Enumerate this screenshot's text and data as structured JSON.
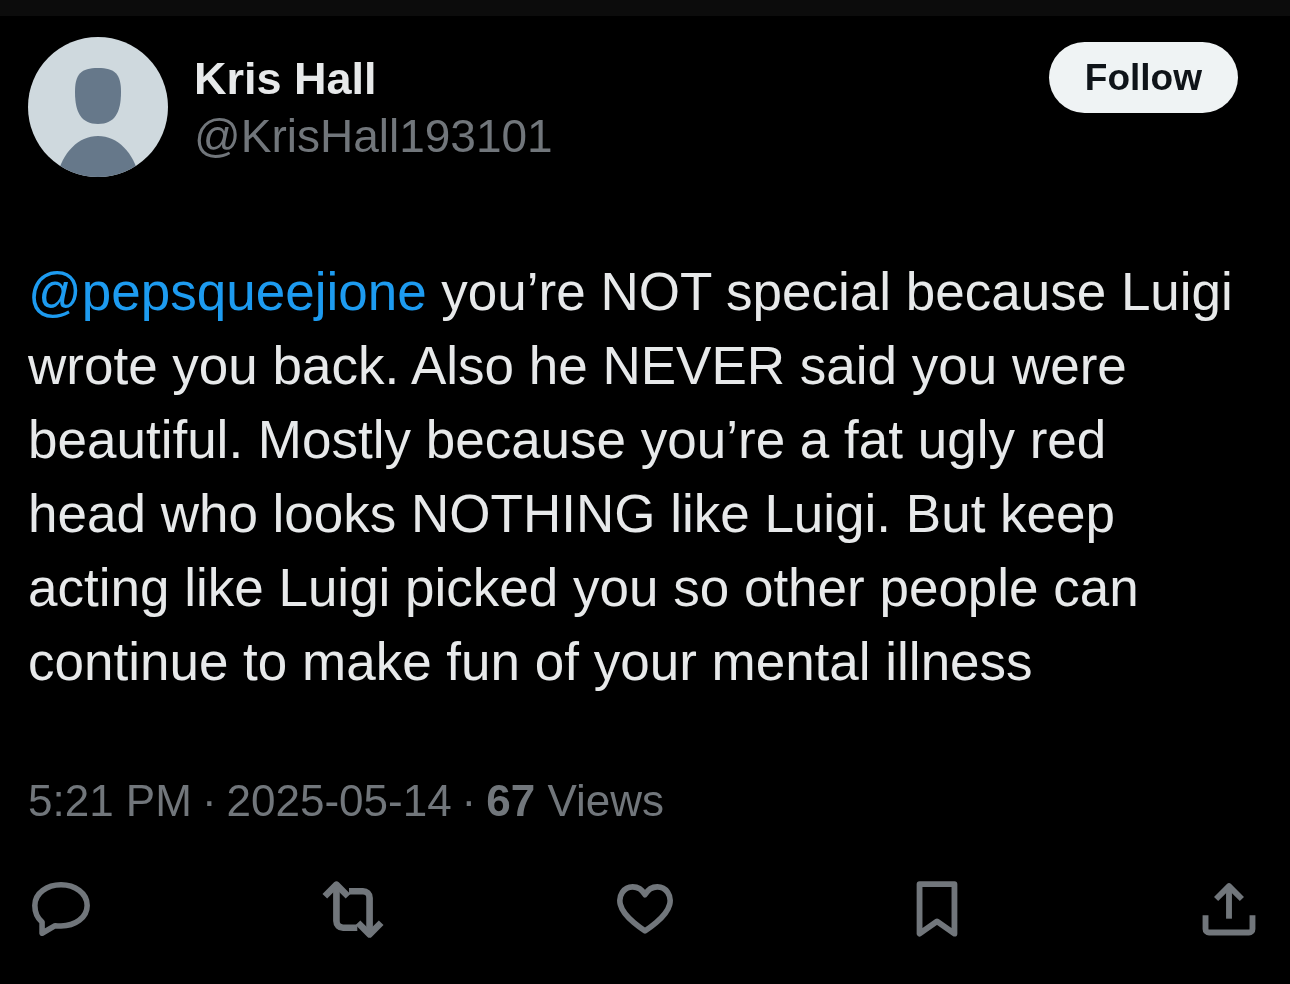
{
  "author": {
    "name": "Kris Hall",
    "handle": "@KrisHall193101"
  },
  "follow_button": {
    "label": "Follow"
  },
  "post": {
    "segments": [
      {
        "kind": "mention",
        "text": "@pepsqueejione"
      },
      {
        "kind": "text",
        "text": " you’re NOT special because Luigi wrote you back. Also he NEVER said you were beautiful. Mostly because you’re a fat ugly red head who looks NOTHING like Luigi. But keep acting like Luigi picked you so other people can continue to make fun of your mental illness"
      }
    ]
  },
  "meta": [
    {
      "kind": "time",
      "text": "5:21 PM"
    },
    {
      "kind": "separator",
      "text": "·"
    },
    {
      "kind": "date",
      "text": "2025-05-14"
    },
    {
      "kind": "separator",
      "text": "·"
    },
    {
      "kind": "views",
      "text": "**67** Views"
    }
  ]
}
